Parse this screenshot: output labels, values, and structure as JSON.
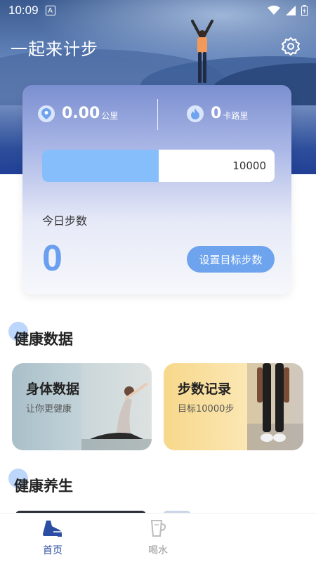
{
  "status_bar": {
    "time": "10:09",
    "notification_glyph": "A"
  },
  "header": {
    "title": "一起来计步"
  },
  "stats": {
    "distance_value": "0.00",
    "distance_unit": "公里",
    "calories_value": "0",
    "calories_unit": "卡路里",
    "progress_fraction": 0.5,
    "goal_steps": "10000",
    "today_label": "今日步数",
    "today_steps": "0",
    "set_goal_label": "设置目标步数"
  },
  "health_data": {
    "title": "健康数据",
    "tiles": [
      {
        "title": "身体数据",
        "subtitle": "让你更健康"
      },
      {
        "title": "步数记录",
        "subtitle": "目标10000步"
      }
    ]
  },
  "wellness": {
    "title": "健康养生"
  },
  "bottom_nav": {
    "items": [
      {
        "label": "首页",
        "icon": "running-shoe-icon",
        "active": true
      },
      {
        "label": "喝水",
        "icon": "cup-icon",
        "active": false
      }
    ]
  },
  "colors": {
    "accent": "#6ea3ee",
    "progress_fill": "#86bdfb",
    "active_nav": "#2b4da3",
    "inactive_nav": "#bdbdbd"
  }
}
